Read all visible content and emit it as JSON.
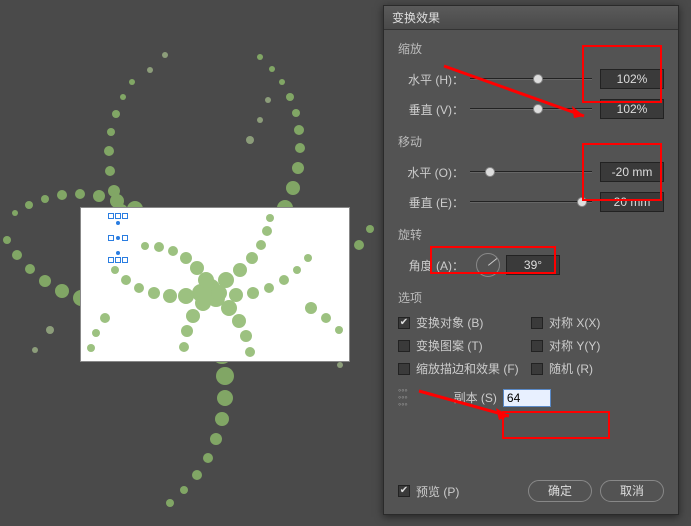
{
  "dialog": {
    "title": "变换效果",
    "scale": {
      "title": "缩放",
      "h_label": "水平 (H)：",
      "h_value": "102%",
      "v_label": "垂直 (V)：",
      "v_value": "102%"
    },
    "move": {
      "title": "移动",
      "h_label": "水平 (O)：",
      "h_value": "-20 mm",
      "v_label": "垂直 (E)：",
      "v_value": "20 mm"
    },
    "rotate": {
      "title": "旋转",
      "angle_label": "角度 (A)：",
      "angle_value": "39°"
    },
    "options": {
      "title": "选项",
      "transform_obj": "变换对象 (B)",
      "transform_pat": "变换图案 (T)",
      "scale_strokes": "缩放描边和效果 (F)",
      "reflect_x": "对称 X(X)",
      "reflect_y": "对称 Y(Y)",
      "random": "随机 (R)",
      "copies_label": "副本 (S)",
      "copies_value": "64"
    },
    "preview": "预览 (P)",
    "ok": "确定",
    "cancel": "取消"
  },
  "chart_data": null
}
